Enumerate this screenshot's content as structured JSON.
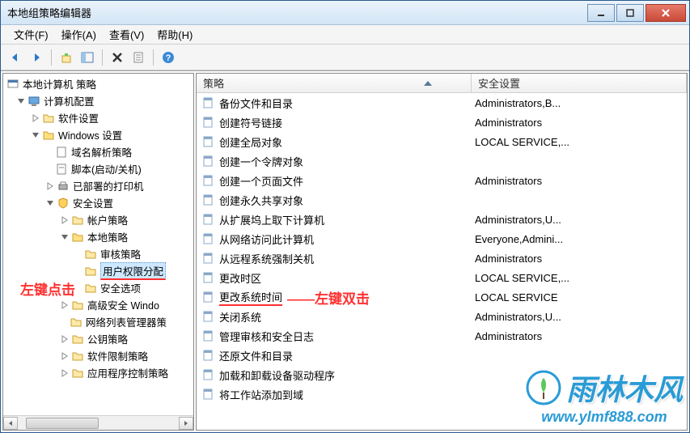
{
  "window": {
    "title": "本地组策略编辑器"
  },
  "menu": {
    "file": "文件(F)",
    "action": "操作(A)",
    "view": "查看(V)",
    "help": "帮助(H)"
  },
  "tree": {
    "root": "本地计算机 策略",
    "n1": "计算机配置",
    "n2": "软件设置",
    "n3": "Windows 设置",
    "n4": "域名解析策略",
    "n5": "脚本(启动/关机)",
    "n6": "已部署的打印机",
    "n7": "安全设置",
    "n8": "帐户策略",
    "n9": "本地策略",
    "n10": "审核策略",
    "n11": "用户权限分配",
    "n12": "安全选项",
    "n13": "高级安全 Windo",
    "n14": "网络列表管理器策",
    "n15": "公钥策略",
    "n16": "软件限制策略",
    "n17": "应用程序控制策略"
  },
  "columns": {
    "c1": "策略",
    "c2": "安全设置"
  },
  "policies": [
    {
      "name": "备份文件和目录",
      "setting": "Administrators,B..."
    },
    {
      "name": "创建符号链接",
      "setting": "Administrators"
    },
    {
      "name": "创建全局对象",
      "setting": "LOCAL SERVICE,..."
    },
    {
      "name": "创建一个令牌对象",
      "setting": ""
    },
    {
      "name": "创建一个页面文件",
      "setting": "Administrators"
    },
    {
      "name": "创建永久共享对象",
      "setting": ""
    },
    {
      "name": "从扩展坞上取下计算机",
      "setting": "Administrators,U..."
    },
    {
      "name": "从网络访问此计算机",
      "setting": "Everyone,Admini..."
    },
    {
      "name": "从远程系统强制关机",
      "setting": "Administrators"
    },
    {
      "name": "更改时区",
      "setting": "LOCAL SERVICE,..."
    },
    {
      "name": "更改系统时间",
      "setting": "LOCAL SERVICE"
    },
    {
      "name": "关闭系统",
      "setting": "Administrators,U..."
    },
    {
      "name": "管理审核和安全日志",
      "setting": "Administrators"
    },
    {
      "name": "还原文件和目录",
      "setting": ""
    },
    {
      "name": "加载和卸载设备驱动程序",
      "setting": ""
    },
    {
      "name": "将工作站添加到域",
      "setting": ""
    }
  ],
  "annot": {
    "left_click": "左键点击",
    "double_click": "——左键双击"
  },
  "watermark": {
    "name": "雨林木风",
    "url": "www.ylmf888.com"
  }
}
